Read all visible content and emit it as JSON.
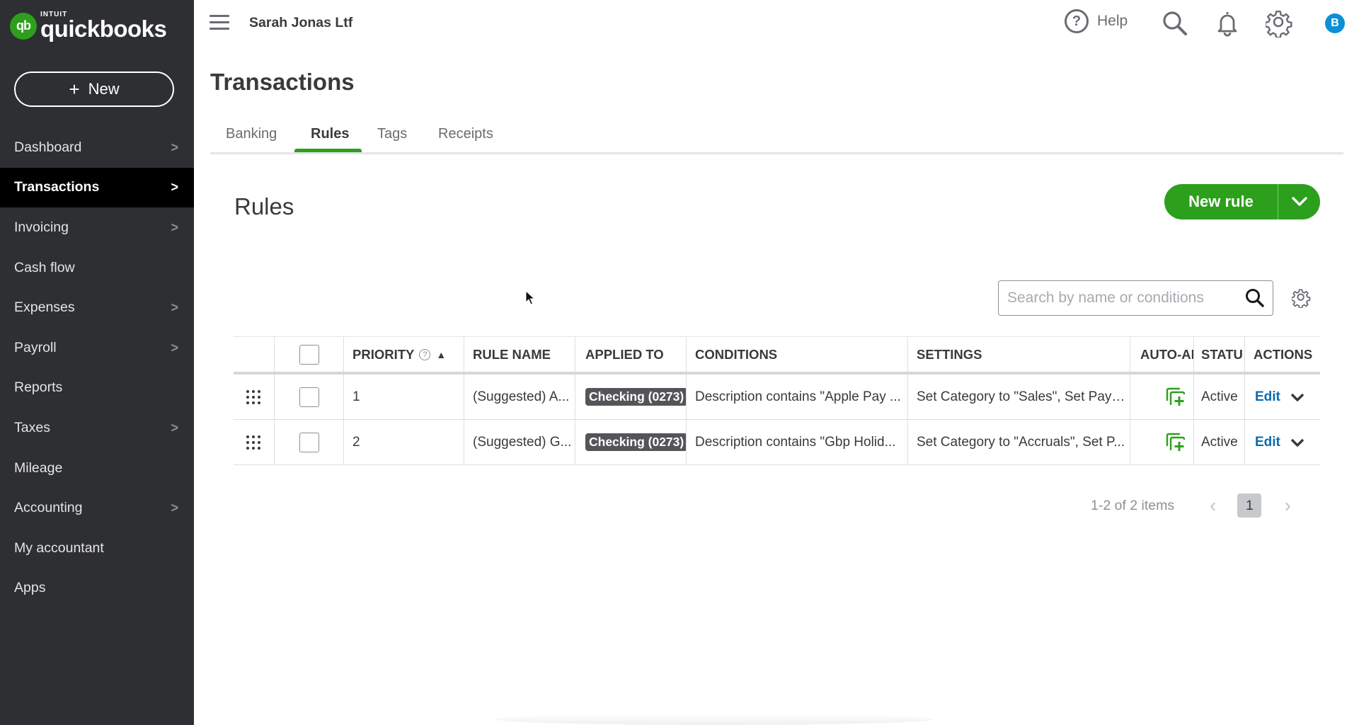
{
  "brand": {
    "mark": "qb",
    "intuit": "INTUIT",
    "name": "quickbooks",
    "accent": "#2ca01c"
  },
  "sidebar": {
    "new_label": "New",
    "items": [
      {
        "label": "Dashboard",
        "has_chevron": true,
        "active": false
      },
      {
        "label": "Transactions",
        "has_chevron": true,
        "active": true
      },
      {
        "label": "Invoicing",
        "has_chevron": true,
        "active": false
      },
      {
        "label": "Cash flow",
        "has_chevron": false,
        "active": false
      },
      {
        "label": "Expenses",
        "has_chevron": true,
        "active": false
      },
      {
        "label": "Payroll",
        "has_chevron": true,
        "active": false
      },
      {
        "label": "Reports",
        "has_chevron": false,
        "active": false
      },
      {
        "label": "Taxes",
        "has_chevron": true,
        "active": false
      },
      {
        "label": "Mileage",
        "has_chevron": false,
        "active": false
      },
      {
        "label": "Accounting",
        "has_chevron": true,
        "active": false
      },
      {
        "label": "My accountant",
        "has_chevron": false,
        "active": false
      },
      {
        "label": "Apps",
        "has_chevron": false,
        "active": false
      }
    ]
  },
  "topbar": {
    "company": "Sarah Jonas Ltf",
    "help_label": "Help",
    "help_glyph": "?",
    "avatar_initial": "B",
    "icons": [
      "menu-icon",
      "help-icon",
      "search-icon",
      "bell-icon",
      "gear-icon"
    ]
  },
  "page": {
    "title": "Transactions",
    "tabs": [
      {
        "label": "Banking",
        "active": false
      },
      {
        "label": "Rules",
        "active": true
      },
      {
        "label": "Tags",
        "active": false
      },
      {
        "label": "Receipts",
        "active": false
      }
    ]
  },
  "rules": {
    "title": "Rules",
    "new_rule_label": "New rule",
    "search_placeholder": "Search by name or conditions",
    "search_value": "",
    "columns": {
      "priority": "PRIORITY",
      "priority_help": "?",
      "sort_indicator": "▲",
      "rule_name": "RULE NAME",
      "applied_to": "APPLIED TO",
      "conditions": "CONDITIONS",
      "settings": "SETTINGS",
      "auto_add": "AUTO-AI",
      "status": "STATU",
      "actions": "ACTIONS"
    },
    "rows": [
      {
        "priority": "1",
        "rule_name": "(Suggested) A...",
        "applied_to": "Checking (0273)",
        "conditions": "Description contains \"Apple Pay ...",
        "settings": "Set Category to \"Sales\", Set Paye...",
        "auto_add": true,
        "status": "Active",
        "action": "Edit"
      },
      {
        "priority": "2",
        "rule_name": "(Suggested) G...",
        "applied_to": "Checking (0273)",
        "conditions": "Description contains \"Gbp Holid...",
        "settings": "Set Category to \"Accruals\", Set P...",
        "auto_add": true,
        "status": "Active",
        "action": "Edit"
      }
    ],
    "pagination": {
      "summary": "1-2 of 2 items",
      "current_page": "1",
      "prev": "‹",
      "next": "›"
    }
  }
}
